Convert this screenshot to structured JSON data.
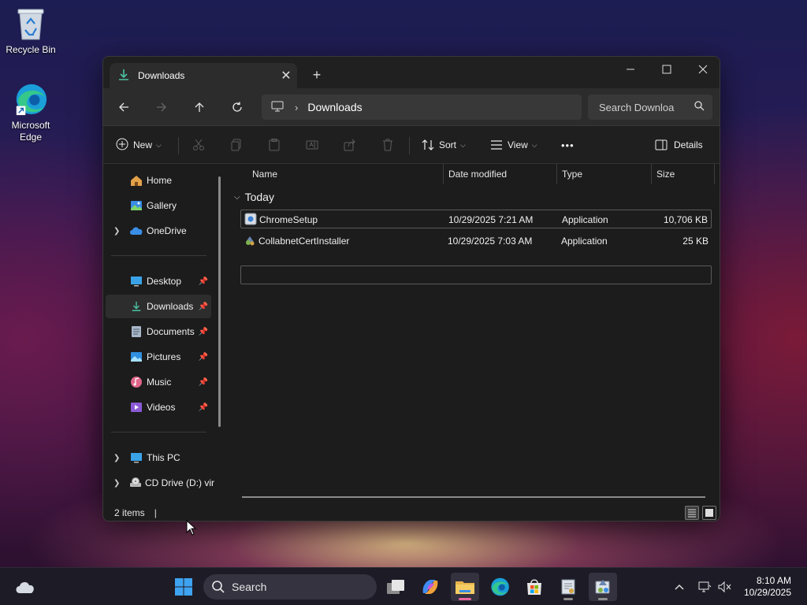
{
  "desktop": {
    "icons": [
      {
        "label": "Recycle Bin"
      },
      {
        "label": "Microsoft Edge"
      }
    ]
  },
  "window": {
    "tab_title": "Downloads",
    "new_tab": "+",
    "breadcrumb": "Downloads",
    "search_placeholder": "Search Downloa",
    "toolbar": {
      "new_label": "New",
      "sort_label": "Sort",
      "view_label": "View",
      "more_label": "•••",
      "details_label": "Details"
    },
    "sidebar": {
      "top": [
        {
          "label": "Home"
        },
        {
          "label": "Gallery"
        },
        {
          "label": "OneDrive"
        }
      ],
      "pinned": [
        {
          "label": "Desktop"
        },
        {
          "label": "Downloads"
        },
        {
          "label": "Documents"
        },
        {
          "label": "Pictures"
        },
        {
          "label": "Music"
        },
        {
          "label": "Videos"
        }
      ],
      "bottom": [
        {
          "label": "This PC"
        },
        {
          "label": "CD Drive (D:) vir"
        }
      ]
    },
    "columns": {
      "name": "Name",
      "date": "Date modified",
      "type": "Type",
      "size": "Size"
    },
    "group_label": "Today",
    "files": [
      {
        "name": "ChromeSetup",
        "date": "10/29/2025 7:21 AM",
        "type": "Application",
        "size": "10,706 KB"
      },
      {
        "name": "CollabnetCertInstaller",
        "date": "10/29/2025 7:03 AM",
        "type": "Application",
        "size": "25 KB"
      }
    ],
    "status": "2 items"
  },
  "taskbar": {
    "search_label": "Search",
    "time": "8:10 AM",
    "date": "10/29/2025"
  },
  "colors": {
    "accent_folder": "#e8b64a",
    "download_green": "#4cc2a3",
    "onedrive_blue": "#3a8ee6"
  }
}
